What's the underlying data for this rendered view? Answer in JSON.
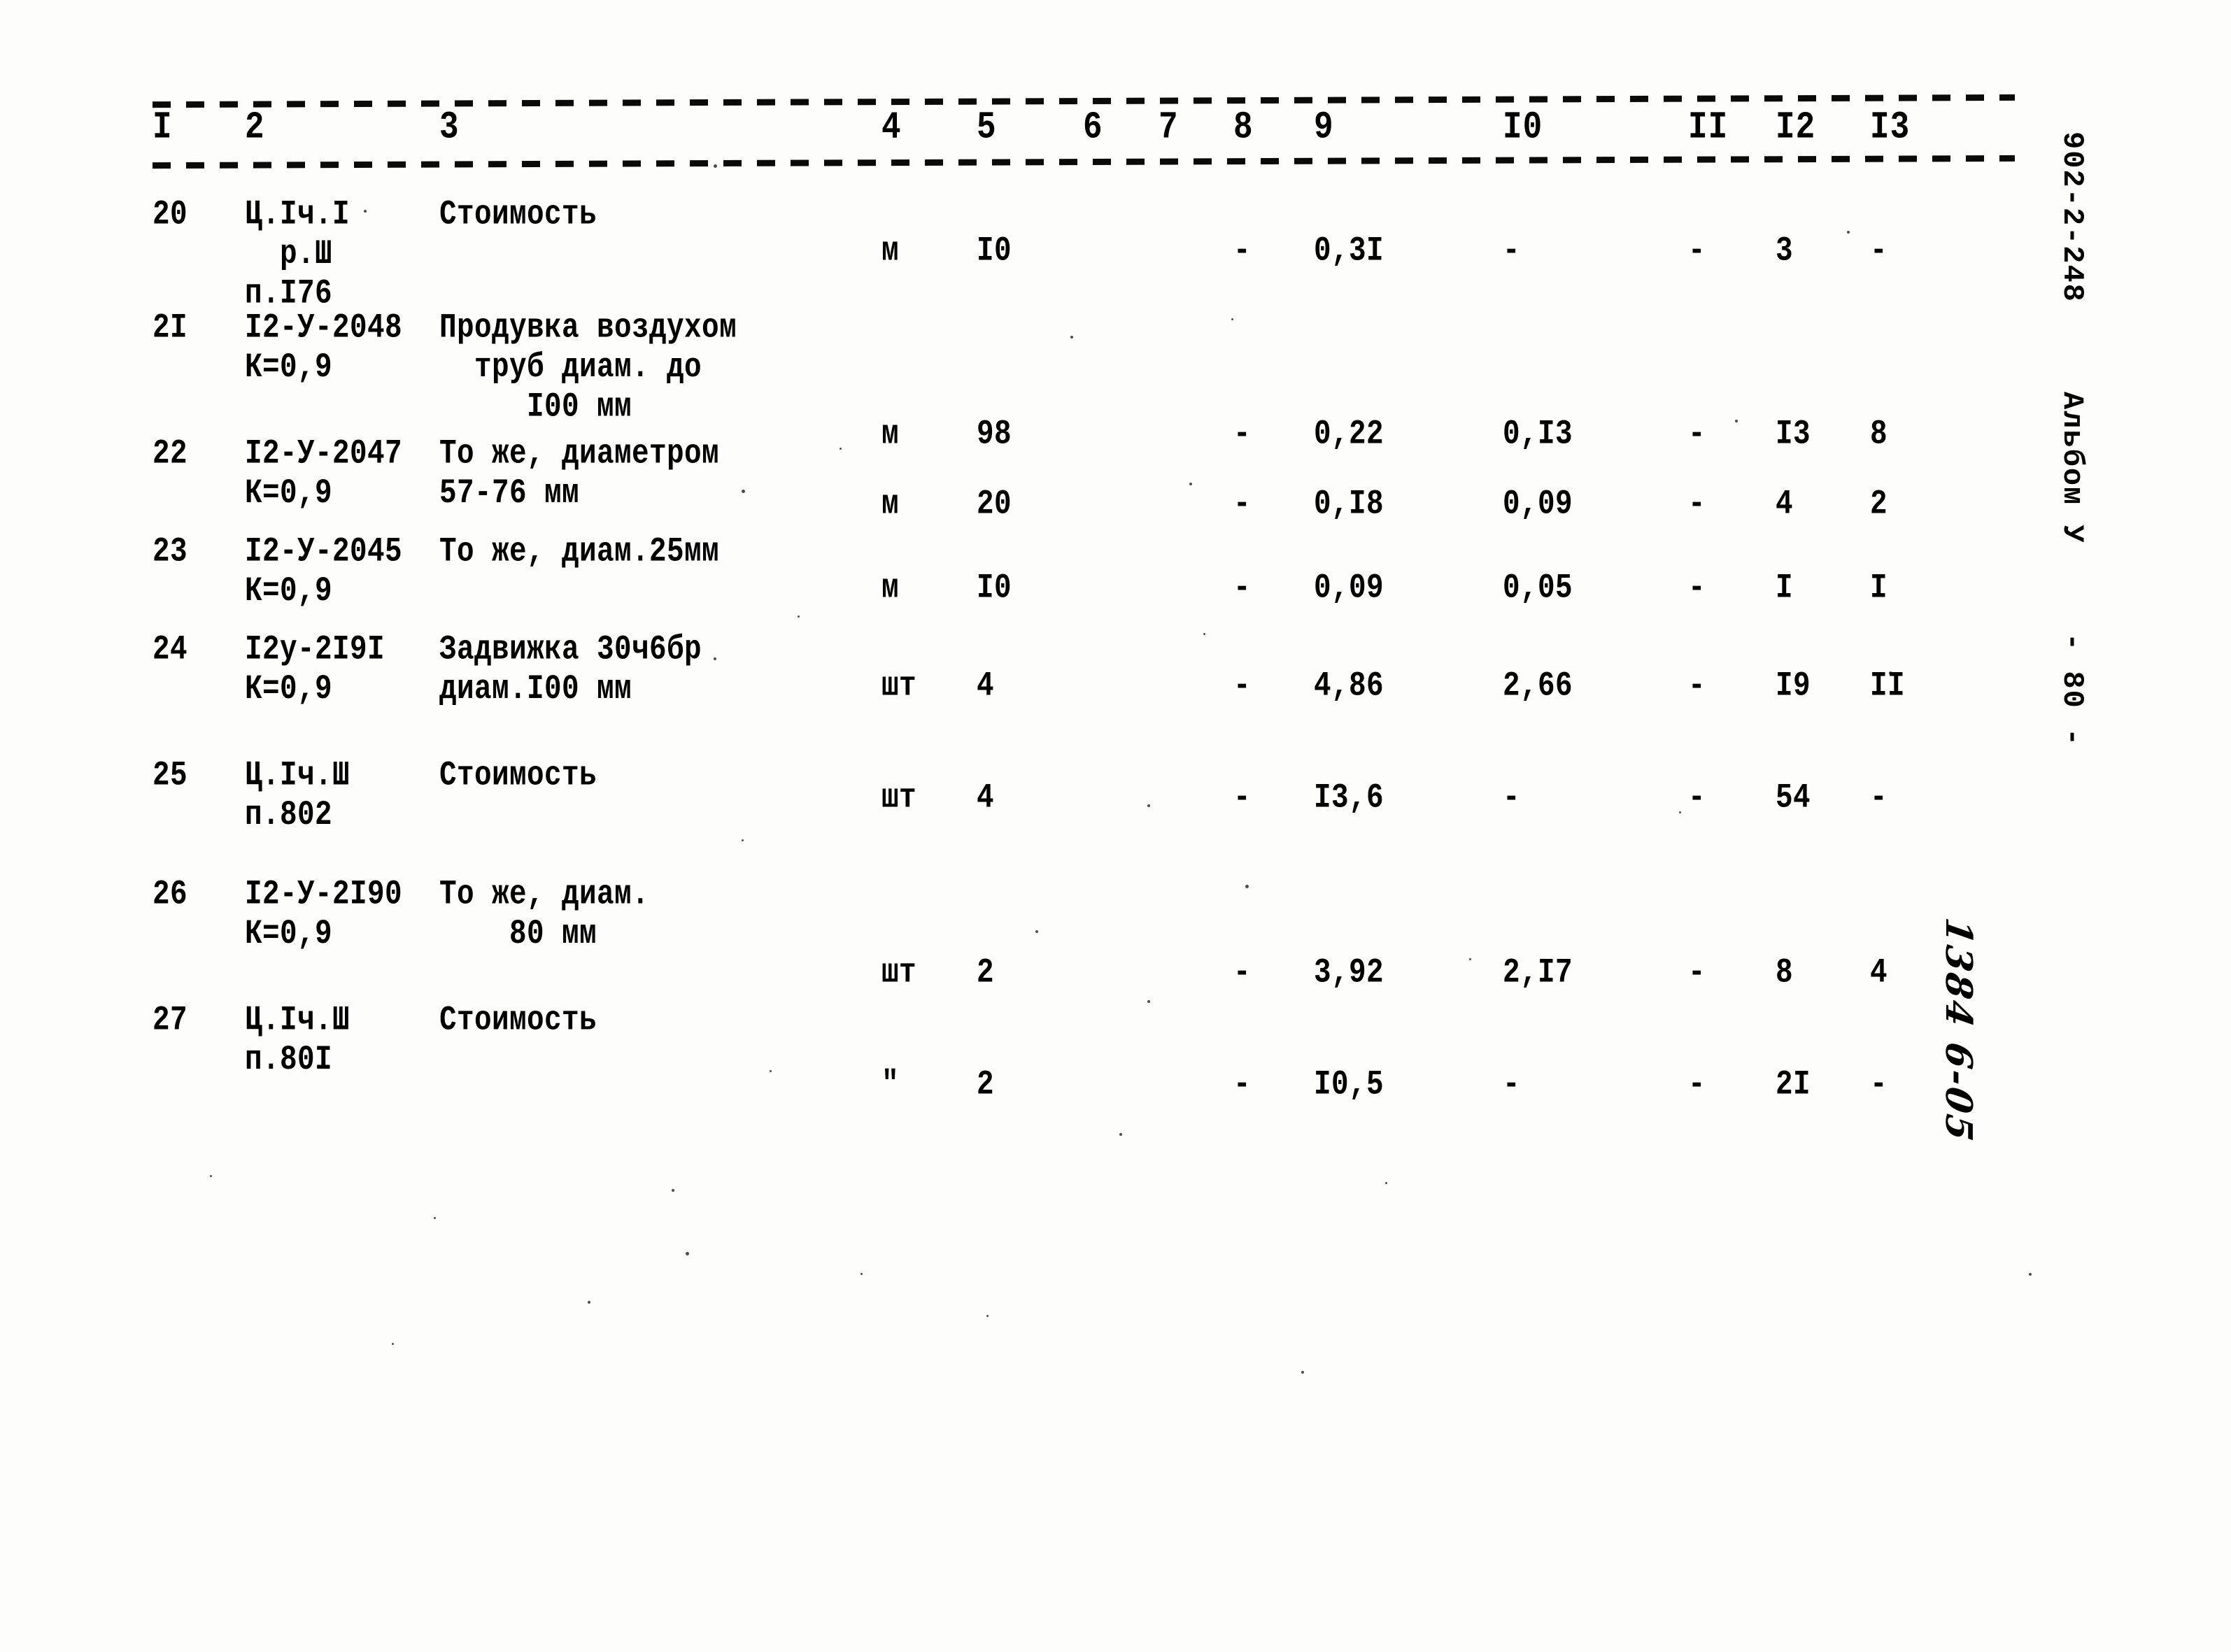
{
  "document": {
    "margin_code": "902-2-248",
    "margin_album": "Альбом У",
    "margin_page": "- 80 -",
    "handwritten_note": "1384 6-05"
  },
  "table": {
    "column_headers": [
      "I",
      "2",
      "3",
      "4",
      "5",
      "6",
      "7",
      "8",
      "9",
      "I0",
      "II",
      "I2",
      "I3"
    ],
    "rows": [
      {
        "num": "20",
        "code": "Ц.Iч.I\n  р.Ш\nп.I76",
        "desc": "Стоимость",
        "c4": "м",
        "c5": "I0",
        "c6": "",
        "c7": "",
        "c8": "-",
        "c9": "0,3I",
        "c10": "-",
        "c11": "-",
        "c12": "3",
        "c13": "-"
      },
      {
        "num": "2I",
        "code": "I2-У-2048\nК=0,9",
        "desc": "Продувка воздухом\n  труб диам. до\n     I00 мм",
        "c4": "м",
        "c5": "98",
        "c6": "",
        "c7": "",
        "c8": "-",
        "c9": "0,22",
        "c10": "0,I3",
        "c11": "-",
        "c12": "I3",
        "c13": "8"
      },
      {
        "num": "22",
        "code": "I2-У-2047\nК=0,9",
        "desc": "То же, диаметром\n57-76 мм",
        "c4": "м",
        "c5": "20",
        "c6": "",
        "c7": "",
        "c8": "-",
        "c9": "0,I8",
        "c10": "0,09",
        "c11": "-",
        "c12": "4",
        "c13": "2"
      },
      {
        "num": "23",
        "code": "I2-У-2045\nК=0,9",
        "desc": "То же, диам.25мм",
        "c4": "м",
        "c5": "I0",
        "c6": "",
        "c7": "",
        "c8": "-",
        "c9": "0,09",
        "c10": "0,05",
        "c11": "-",
        "c12": "I",
        "c13": "I"
      },
      {
        "num": "24",
        "code": "I2у-2I9I\nК=0,9",
        "desc": "Задвижка 30ч6бр\nдиам.I00 мм",
        "c4": "шт",
        "c5": "4",
        "c6": "",
        "c7": "",
        "c8": "-",
        "c9": "4,86",
        "c10": "2,66",
        "c11": "-",
        "c12": "I9",
        "c13": "II"
      },
      {
        "num": "25",
        "code": "Ц.Iч.Ш\nп.802",
        "desc": "Стоимость",
        "c4": "шт",
        "c5": "4",
        "c6": "",
        "c7": "",
        "c8": "-",
        "c9": "I3,6",
        "c10": "-",
        "c11": "-",
        "c12": "54",
        "c13": "-"
      },
      {
        "num": "26",
        "code": "I2-У-2I90\nК=0,9",
        "desc": "То же, диам.\n    80 мм",
        "c4": "шт",
        "c5": "2",
        "c6": "",
        "c7": "",
        "c8": "-",
        "c9": "3,92",
        "c10": "2,I7",
        "c11": "-",
        "c12": "8",
        "c13": "4"
      },
      {
        "num": "27",
        "code": "Ц.Iч.Ш\nп.80I",
        "desc": "Стоимость",
        "c4": "\"",
        "c5": "2",
        "c6": "",
        "c7": "",
        "c8": "-",
        "c9": "I0,5",
        "c10": "-",
        "c11": "-",
        "c12": "2I",
        "c13": "-"
      }
    ]
  }
}
